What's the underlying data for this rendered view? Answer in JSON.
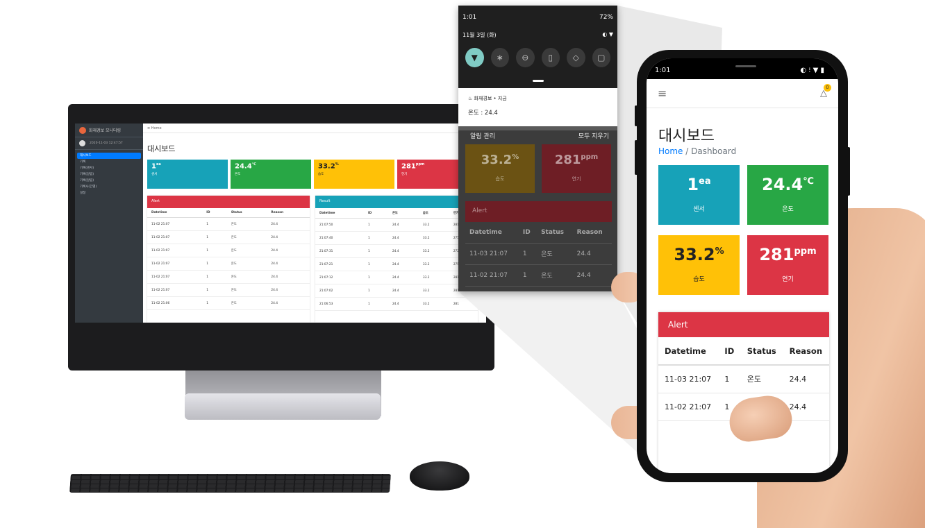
{
  "desktop": {
    "brand": "화재경보 모니터링",
    "user_time": "2020-11-03 12:47:57",
    "nav": [
      "대시보드",
      "기록",
      "기록(센서)",
      "기록(알림)",
      "기록(알림)",
      "기록시(간별)",
      "설정"
    ],
    "topbar": "≡  Home",
    "page_title": "대시보드",
    "breadcrumb": "Home /",
    "boxes": [
      {
        "value": "1",
        "unit": "ea",
        "label": "센서",
        "color": "#17a2b8"
      },
      {
        "value": "24.4",
        "unit": "℃",
        "label": "온도",
        "color": "#28a745"
      },
      {
        "value": "33.2",
        "unit": "%",
        "label": "습도",
        "color": "#ffc107"
      },
      {
        "value": "281",
        "unit": "ppm",
        "label": "연기",
        "color": "#dc3545"
      }
    ],
    "alert": {
      "title": "Alert",
      "headers": [
        "Datetime",
        "ID",
        "Status",
        "Reason"
      ],
      "rows": [
        [
          "11-02 21:07",
          "1",
          "온도",
          "24.4"
        ],
        [
          "11-02 21:07",
          "1",
          "온도",
          "24.4"
        ],
        [
          "11-02 21:07",
          "1",
          "온도",
          "24.4"
        ],
        [
          "11-02 21:07",
          "1",
          "온도",
          "24.4"
        ],
        [
          "11-02 21:07",
          "1",
          "온도",
          "24.4"
        ],
        [
          "11-02 21:07",
          "1",
          "온도",
          "24.4"
        ],
        [
          "11-02 21:06",
          "1",
          "온도",
          "24.4"
        ]
      ]
    },
    "result": {
      "title": "Result",
      "headers": [
        "Datetime",
        "ID",
        "온도",
        "습도",
        "연기"
      ],
      "rows": [
        [
          "21:07:50",
          "1",
          "24.4",
          "33.2",
          "281"
        ],
        [
          "21:07:40",
          "1",
          "24.4",
          "33.2",
          "275"
        ],
        [
          "21:07:31",
          "1",
          "24.4",
          "33.2",
          "272"
        ],
        [
          "21:07:21",
          "1",
          "24.4",
          "33.2",
          "275"
        ],
        [
          "21:07:12",
          "1",
          "24.4",
          "33.2",
          "281"
        ],
        [
          "21:07:02",
          "1",
          "24.4",
          "33.2",
          "281"
        ],
        [
          "21:06:53",
          "1",
          "24.4",
          "33.2",
          "281"
        ]
      ]
    }
  },
  "notification": {
    "time": "1:01",
    "battery": "72%",
    "date": "11월 3일 (화)",
    "tiles": [
      "wifi-icon",
      "bluetooth-icon",
      "dnd-icon",
      "flashlight-icon",
      "rotate-icon",
      "battery-saver-icon"
    ],
    "app": "화재경보 • 지금",
    "message": "온도 : 24.4",
    "manage": "알림 관리",
    "clear_all": "모두 지우기",
    "boxes": [
      {
        "value": "33.2",
        "unit": "%",
        "label": "습도",
        "color": "#6b5213"
      },
      {
        "value": "281",
        "unit": "ppm",
        "label": "연기",
        "color": "#6e1e25"
      }
    ],
    "alert_title": "Alert",
    "headers": [
      "Datetime",
      "ID",
      "Status",
      "Reason"
    ],
    "rows": [
      [
        "11-03 21:07",
        "1",
        "온도",
        "24.4"
      ],
      [
        "11-02 21:07",
        "1",
        "온도",
        "24.4"
      ]
    ]
  },
  "phone": {
    "time": "1:01",
    "page_title": "대시보드",
    "breadcrumb_home": "Home",
    "breadcrumb_sep": " / ",
    "breadcrumb_current": "Dashboard",
    "badge": "0",
    "boxes": [
      {
        "value": "1",
        "unit": "ea",
        "label": "센서",
        "color": "#17a2b8"
      },
      {
        "value": "24.4",
        "unit": "℃",
        "label": "온도",
        "color": "#28a745"
      },
      {
        "value": "33.2",
        "unit": "%",
        "label": "습도",
        "color": "#ffc107"
      },
      {
        "value": "281",
        "unit": "ppm",
        "label": "연기",
        "color": "#dc3545"
      }
    ],
    "alert": {
      "title": "Alert",
      "headers": [
        "Datetime",
        "ID",
        "Status",
        "Reason"
      ],
      "rows": [
        [
          "11-03 21:07",
          "1",
          "온도",
          "24.4"
        ],
        [
          "11-02 21:07",
          "1",
          "온도",
          "24.4"
        ]
      ]
    }
  }
}
